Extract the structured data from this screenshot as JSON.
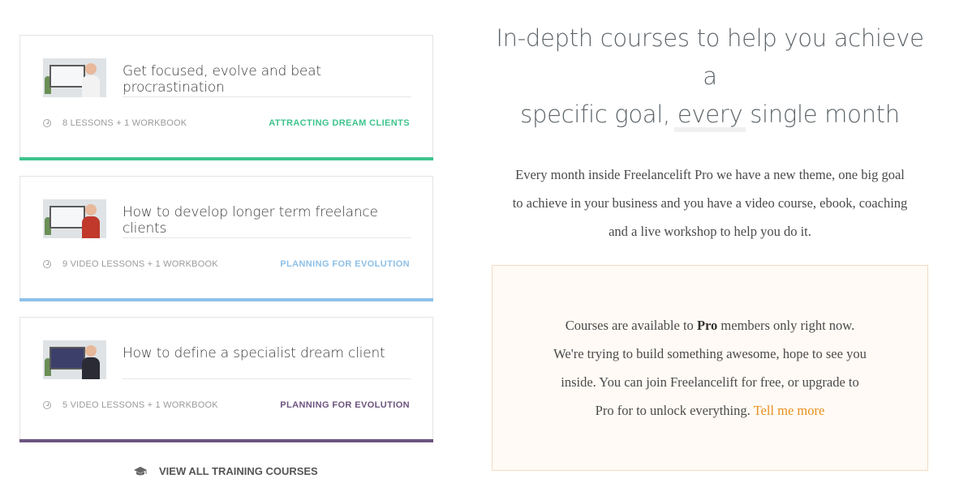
{
  "courses": [
    {
      "title": "Get focused, evolve and beat procrastination",
      "meta": "8 LESSONS + 1 WORKBOOK",
      "tag": "ATTRACTING DREAM CLIENTS",
      "color": "#3dc48c"
    },
    {
      "title": "How to develop longer term freelance clients",
      "meta": "9 VIDEO LESSONS + 1 WORKBOOK",
      "tag": "PLANNING FOR EVOLUTION",
      "color": "#8ec0e8"
    },
    {
      "title": "How to define a specialist dream client",
      "meta": "5 VIDEO LESSONS + 1 WORKBOOK",
      "tag": "PLANNING FOR EVOLUTION",
      "color": "#6c547f"
    }
  ],
  "view_all_label": "VIEW ALL TRAINING COURSES",
  "heading": {
    "line1": "In-depth courses to help you achieve a",
    "line2": "specific goal, every single month"
  },
  "intro": {
    "line1": "Every month inside Freelancelift Pro we have a new theme, one big goal",
    "line2": "to achieve in your business and you have a video course, ebook, coaching",
    "line3": "and a live workshop to help you do it."
  },
  "notice": {
    "line1_pre": "Courses are available to ",
    "line1_bold": "Pro",
    "line1_post": " members only right now.",
    "line2": "We're trying to build something awesome, hope to see you",
    "line3": "inside. You can join Freelancelift for free, or upgrade to",
    "line4_pre": "Pro for to unlock everything. ",
    "link": "Tell me more"
  },
  "colors": {
    "accent_link": "#e8901e",
    "notice_bg": "#fffaf5",
    "notice_border": "#f3dcc4"
  },
  "icons": {
    "meta_icon": "clock-icon",
    "view_all_icon": "graduation-cap-icon"
  }
}
